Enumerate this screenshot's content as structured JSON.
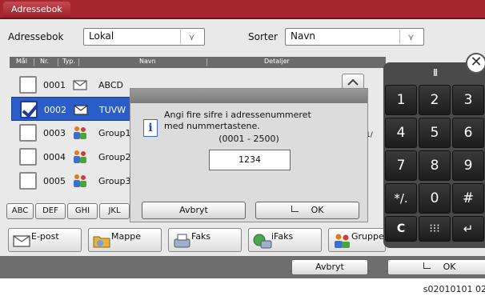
{
  "window": {
    "tab_title": "Adressebok"
  },
  "toolbar": {
    "addressbook_label": "Adressebok",
    "addressbook_value": "Lokal",
    "sort_label": "Sorter",
    "sort_value": "Navn"
  },
  "list": {
    "columns": [
      "Mål",
      "Nr.",
      "Typ.",
      "Navn",
      "Detaljer"
    ],
    "rows": [
      {
        "number": "0001",
        "type_icon": "email-icon",
        "name": "ABCD",
        "checked": false
      },
      {
        "number": "0002",
        "type_icon": "email-icon",
        "name": "TUVW",
        "checked": true
      },
      {
        "number": "0003",
        "type_icon": "group-icon",
        "name": "Group1",
        "checked": false
      },
      {
        "number": "0004",
        "type_icon": "group-icon",
        "name": "Group2",
        "checked": false
      },
      {
        "number": "0005",
        "type_icon": "group-icon",
        "name": "Group3",
        "checked": false
      }
    ],
    "page_indicator": "1/"
  },
  "filters": [
    "ABC",
    "DEF",
    "GHI",
    "JKL"
  ],
  "destinations": [
    {
      "label": "E-post",
      "icon": "email-icon"
    },
    {
      "label": "Mappe",
      "icon": "folder-icon"
    },
    {
      "label": "Faks",
      "icon": "fax-icon"
    },
    {
      "label": "iFaks",
      "icon": "ifax-icon"
    },
    {
      "label": "Gruppe",
      "icon": "group-icon"
    }
  ],
  "dialog": {
    "message": "Angi fire sifre i adressenummeret\nmed nummertastene.",
    "range": "(0001 - 2500)",
    "input_value": "1234",
    "cancel_label": "Avbryt",
    "ok_label": "OK"
  },
  "keypad": {
    "grip": "III",
    "keys": [
      "1",
      "2",
      "3",
      "4",
      "5",
      "6",
      "7",
      "8",
      "9",
      "*/.",
      "0",
      "#",
      "C",
      "⁝⁝⁝",
      "↵"
    ]
  },
  "footer": {
    "cancel_label": "Avbryt",
    "ok_label": "OK"
  },
  "caption": "s02010101 02",
  "colors": {
    "titlebar": "#a7262e",
    "selection": "#2a5dc9",
    "keypad": "#4a4a4a"
  }
}
